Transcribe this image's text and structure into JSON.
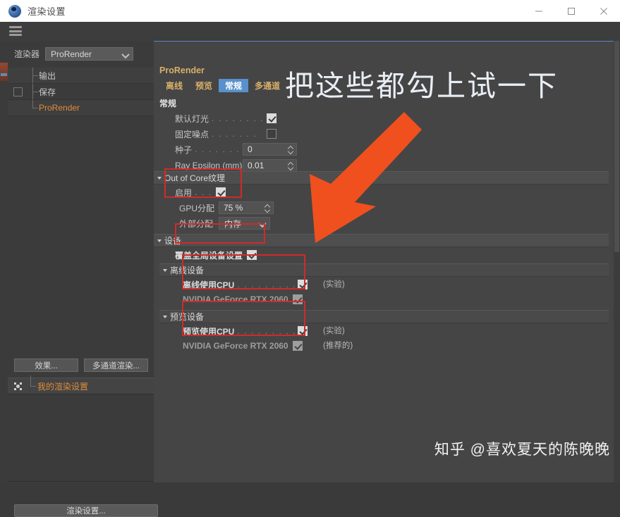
{
  "window": {
    "title": "渲染设置",
    "app_icon": "cinema4d-icon",
    "controls": {
      "minimize": "minimize-icon",
      "maximize": "maximize-icon",
      "close": "close-icon"
    }
  },
  "menu": {
    "hamburger": "hamburger-menu-icon"
  },
  "left_panel": {
    "renderer_label": "渲染器",
    "renderer_value": "ProRender",
    "renderer_options": [
      "ProRender"
    ],
    "tree": [
      {
        "label": "输出",
        "accent": false,
        "checkbox": false,
        "checked": false
      },
      {
        "label": "保存",
        "accent": false,
        "checkbox": true,
        "checked": false
      },
      {
        "label": "ProRender",
        "accent": true,
        "checkbox": false,
        "checked": false
      }
    ],
    "buttons": {
      "effects": "效果...",
      "multipass": "多通道渲染..."
    },
    "my_setting": "我的渲染设置",
    "render_settings_button": "渲染设置..."
  },
  "content": {
    "title": "ProRender",
    "tabs": [
      {
        "label": "离线",
        "active": false
      },
      {
        "label": "预览",
        "active": false
      },
      {
        "label": "常规",
        "active": true
      },
      {
        "label": "多通道",
        "active": false
      }
    ],
    "section_label": "常规",
    "general": [
      {
        "label": "默认灯光",
        "dots": ". . . . . . . .",
        "checked": true
      },
      {
        "label": "固定噪点",
        "dots": ". . . . . . .",
        "checked": false
      }
    ],
    "fields": [
      {
        "label": "种子",
        "dots": ". . . . . . . . . . .",
        "value": "0"
      },
      {
        "label": "Ray Epsilon (mm)",
        "dots": "",
        "value": "0.01"
      }
    ],
    "out_of_core": {
      "group_label": "Out of Core纹理",
      "enable_label": "启用",
      "enable_dots": ". . .",
      "enable_checked": true,
      "gpu_label": "GPU分配",
      "gpu_value": "75 %",
      "external_label": "外部分配",
      "external_value": "内存",
      "external_options": [
        "内存"
      ]
    },
    "devices": {
      "group_label": "设备",
      "override_label": "覆盖全局设备设置",
      "override_checked": true,
      "offline": {
        "group_label": "离线设备",
        "rows": [
          {
            "label": "离线使用CPU",
            "dots": ". . . . . . . . . .",
            "checked": true,
            "dim": false,
            "note": "(实验)"
          },
          {
            "label": "NVIDIA GeForce RTX 2060",
            "dots": "",
            "checked": true,
            "dim": true,
            "note": ""
          }
        ]
      },
      "preview": {
        "group_label": "预览设备",
        "rows": [
          {
            "label": "预览使用CPU",
            "dots": ". . . . . . . . . .",
            "checked": true,
            "dim": false,
            "note": "(实验)"
          },
          {
            "label": "NVIDIA GeForce RTX 2060",
            "dots": "",
            "checked": true,
            "dim": true,
            "note": "(推荐的)"
          }
        ]
      }
    }
  },
  "annotation": {
    "text": "把这些都勾上试一下",
    "arrow_color": "#f0501e",
    "box_color": "#d12a2a"
  },
  "watermark": {
    "text": "知乎 @喜欢夏天的陈晚晚"
  },
  "colors": {
    "accent_orange": "#e08c3a",
    "tab_gold": "#d8b06a",
    "tab_active_bg": "#5891cc",
    "panel_bg": "#3b3b3b",
    "content_bg": "#454545"
  }
}
